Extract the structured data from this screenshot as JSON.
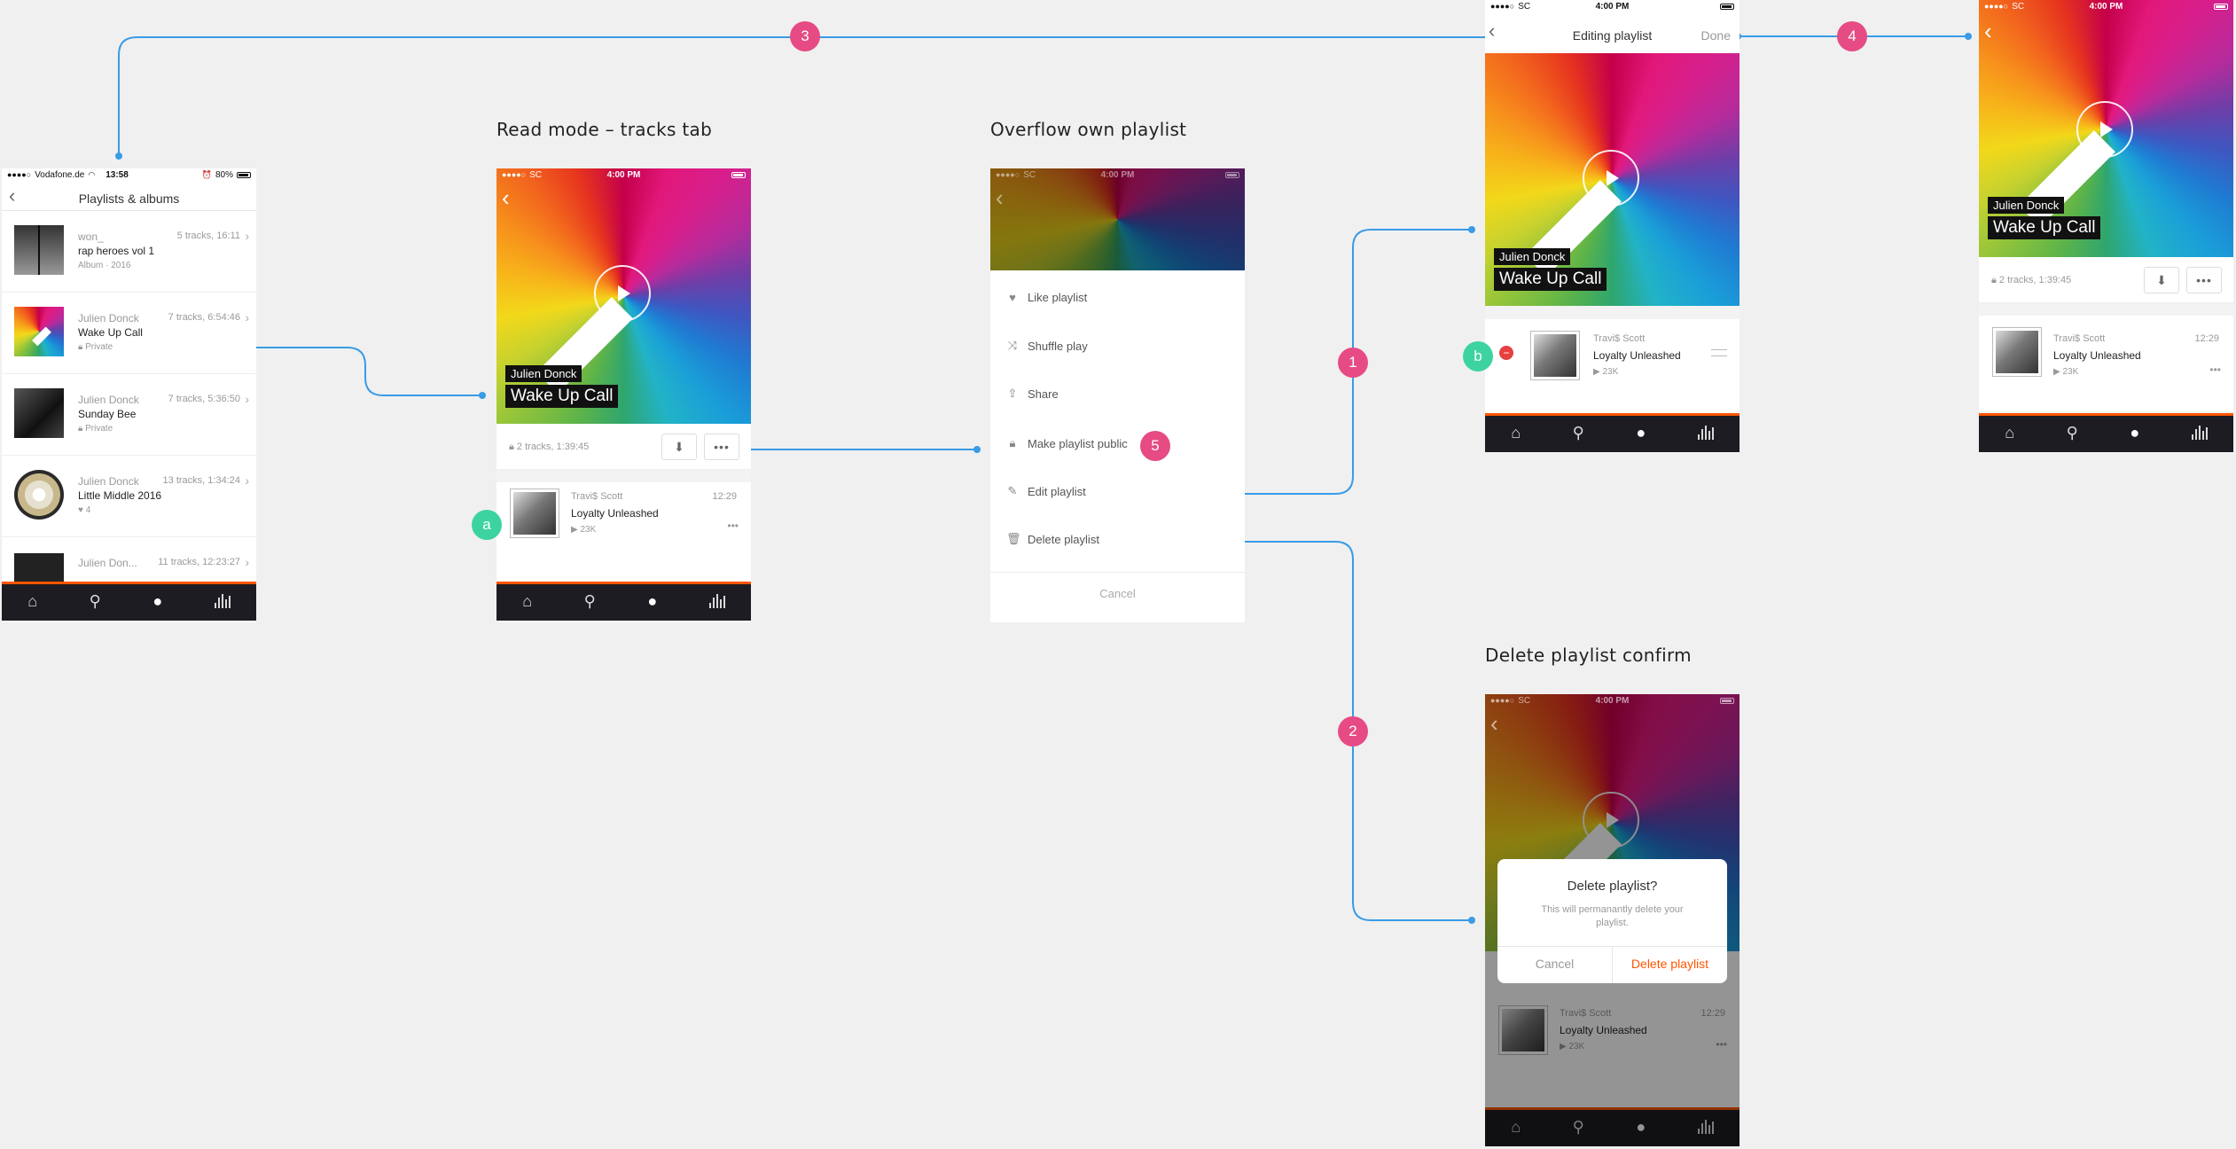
{
  "sections": {
    "read_mode": "Read mode – tracks tab",
    "overflow": "Overflow own playlist",
    "delete_confirm": "Delete playlist confirm"
  },
  "markers": {
    "m1": "1",
    "m2": "2",
    "m3": "3",
    "m4": "4",
    "m5": "5",
    "a": "a",
    "b": "b"
  },
  "status": {
    "carrier_vodafone": "Vodafone.de",
    "time_vodafone": "13:58",
    "battery_vodafone": "80%",
    "carrier_sc": "SC",
    "time_sc": "4:00 PM"
  },
  "playlists_screen": {
    "title": "Playlists & albums",
    "items": [
      {
        "user": "won_",
        "title": "rap heroes vol 1",
        "sub": "Album · 2016",
        "meta": "5 tracks, 16:11"
      },
      {
        "user": "Julien Donck",
        "title": "Wake Up Call",
        "sub": "Private",
        "meta": "7 tracks, 6:54:46"
      },
      {
        "user": "Julien Donck",
        "title": "Sunday Bee",
        "sub": "Private",
        "meta": "7 tracks, 5:36:50"
      },
      {
        "user": "Julien Donck",
        "title": "Little Middle 2016",
        "sub": "4",
        "meta": "13 tracks, 1:34:24"
      },
      {
        "user": "Julien Don...",
        "title": "",
        "sub": "",
        "meta": "11 tracks, 12:23:27"
      }
    ]
  },
  "playlist": {
    "artist": "Julien Donck",
    "title": "Wake Up Call",
    "info": "2 tracks, 1:39:45"
  },
  "track": {
    "artist": "Travi$ Scott",
    "title": "Loyalty Unleashed",
    "plays": "23K",
    "duration": "12:29"
  },
  "overflow_menu": {
    "items": [
      "Like playlist",
      "Shuffle play",
      "Share",
      "Make playlist public",
      "Edit playlist",
      "Delete playlist"
    ],
    "cancel": "Cancel"
  },
  "editing": {
    "title": "Editing playlist",
    "done": "Done"
  },
  "delete_dialog": {
    "title": "Delete playlist?",
    "body": "This will permanantly delete your playlist.",
    "cancel": "Cancel",
    "confirm": "Delete playlist"
  },
  "colors": {
    "accent": "#ff5500",
    "marker_pink": "#e64b84",
    "marker_green": "#3dd3a0",
    "line": "#3a9be6"
  }
}
